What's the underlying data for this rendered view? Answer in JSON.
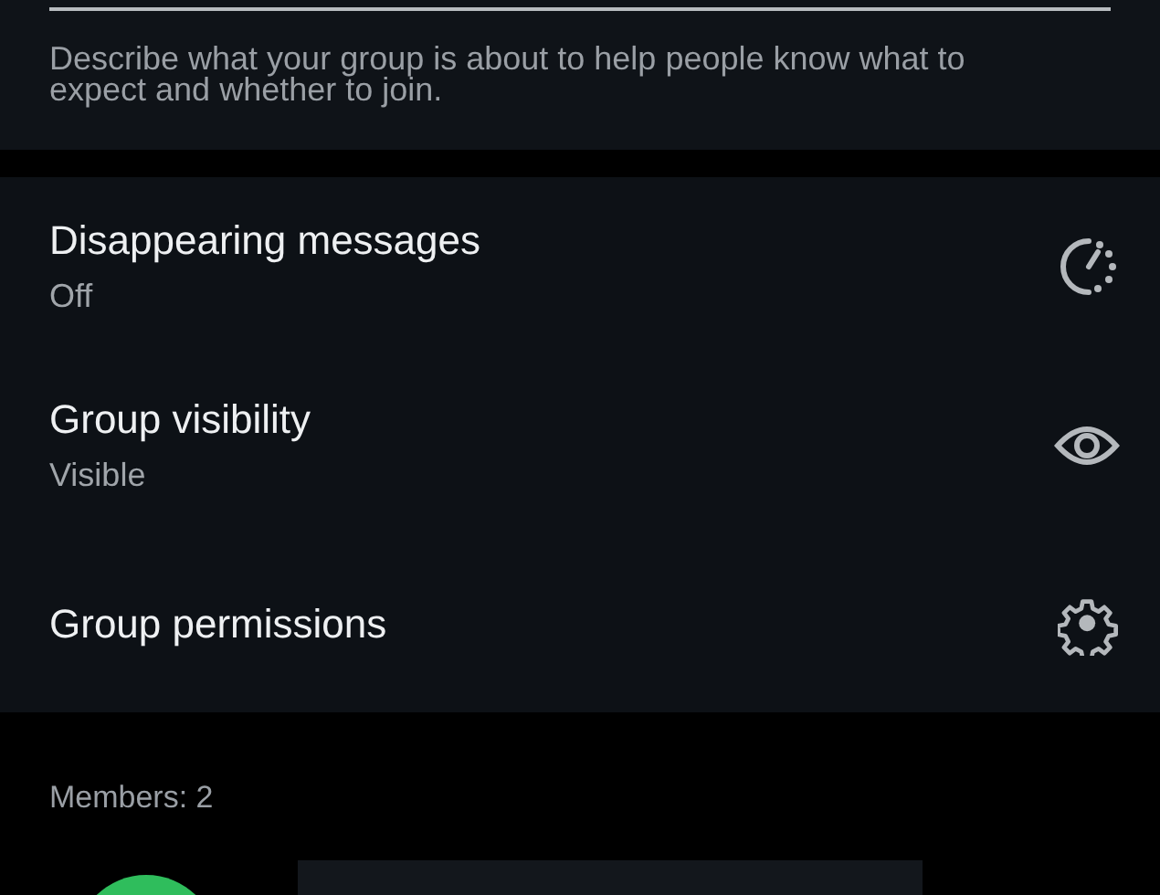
{
  "description_field": {
    "helper_text": "Describe what your group is about to help people know what to expect and whether to join."
  },
  "settings": [
    {
      "title": "Disappearing messages",
      "subtitle": "Off"
    },
    {
      "title": "Group visibility",
      "subtitle": "Visible"
    },
    {
      "title": "Group permissions"
    }
  ],
  "members": {
    "label": "Members: 2"
  }
}
